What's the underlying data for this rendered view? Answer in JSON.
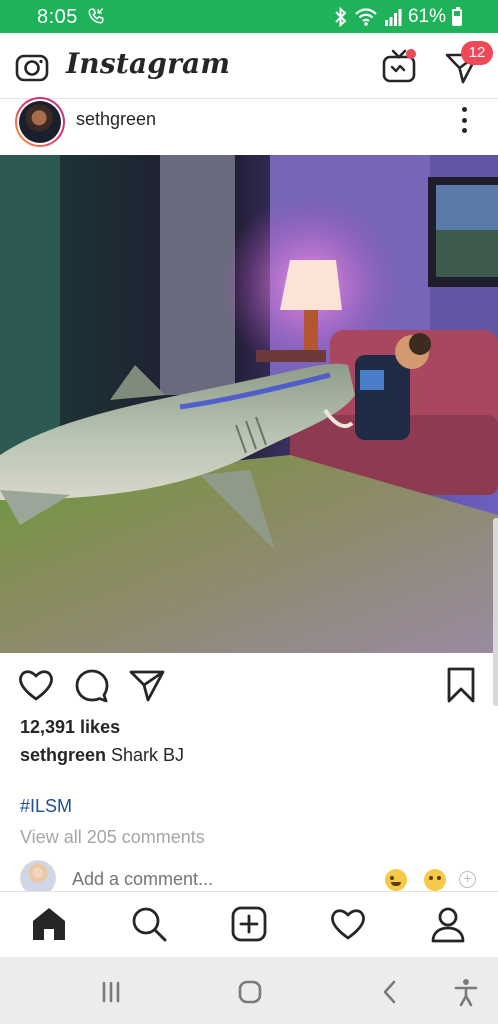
{
  "status_bar": {
    "time": "8:05",
    "battery_percent": "61%",
    "call_icon": "call-icon",
    "bluetooth_icon": "bluetooth-icon",
    "wifi_icon": "wifi-icon",
    "signal_icon": "signal-icon",
    "battery_icon": "battery-icon",
    "bg_color": "#1fb25a"
  },
  "header": {
    "brand": "Instagram",
    "camera_icon": "camera-icon",
    "igtv_icon": "igtv-icon",
    "direct_icon": "direct-message-icon",
    "direct_badge_count": "12",
    "badge_color": "#ed4956"
  },
  "post": {
    "username": "sethgreen",
    "likes": "12,391 likes",
    "caption_user": "sethgreen",
    "caption_text": " Shark BJ",
    "hashtag": "#ILSM",
    "view_comments": "View all 205 comments",
    "comment_placeholder": "Add a comment...",
    "actions": {
      "like_icon": "heart-icon",
      "comment_icon": "comment-icon",
      "share_icon": "share-icon",
      "save_icon": "bookmark-icon"
    }
  },
  "bottom_nav": {
    "items": [
      "home-icon",
      "search-icon",
      "new-post-icon",
      "activity-heart-icon",
      "profile-icon"
    ]
  },
  "system_nav": {
    "items": [
      "recent-apps-icon",
      "home-circle-icon",
      "back-icon",
      "accessibility-icon"
    ]
  }
}
